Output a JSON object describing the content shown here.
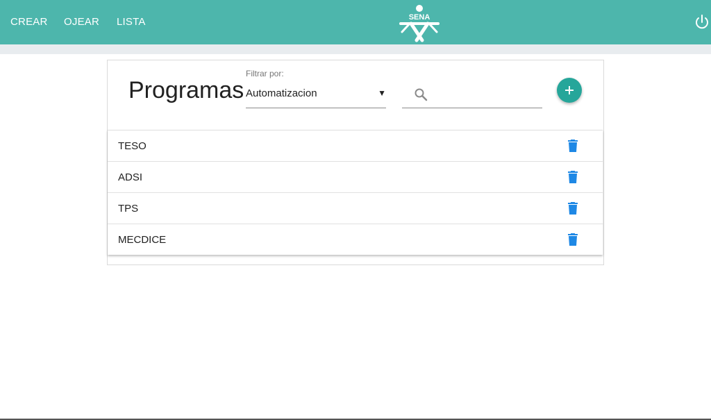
{
  "nav": {
    "links": [
      "CREAR",
      "OJEAR",
      "LISTA"
    ],
    "logo_text": "SENA",
    "logout_icon": "power-icon"
  },
  "page": {
    "title": "Programas"
  },
  "filter": {
    "label": "Filtrar por:",
    "selected": "Automatizacion"
  },
  "search": {
    "placeholder": "",
    "value": ""
  },
  "add_button": {
    "icon": "plus-icon"
  },
  "programs": [
    {
      "name": "TESO"
    },
    {
      "name": "ADSI"
    },
    {
      "name": "TPS"
    },
    {
      "name": "MECDICE"
    }
  ],
  "colors": {
    "header": "#4db6ac",
    "add_button": "#26a69a",
    "delete_icon": "#1e88e5"
  }
}
